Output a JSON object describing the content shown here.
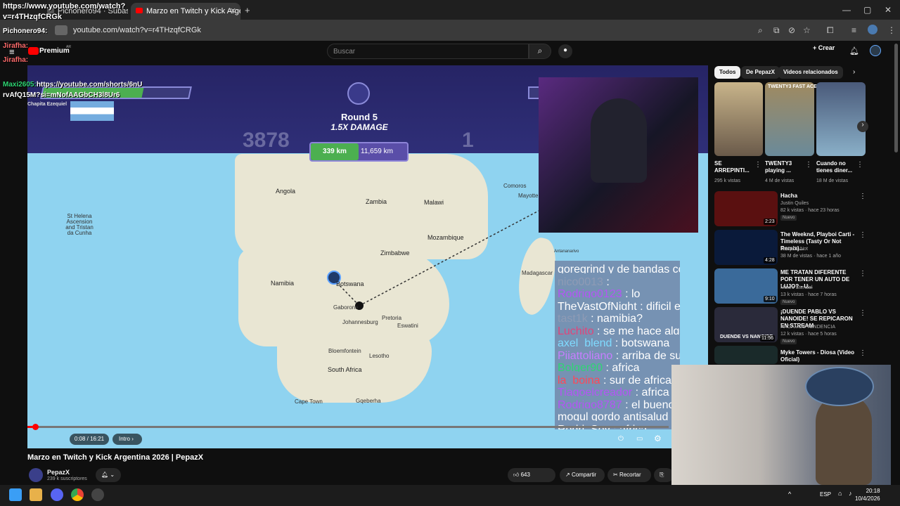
{
  "browser": {
    "tabs": [
      {
        "label": "Pichonero94 · Subasta"
      },
      {
        "label": "Marzo en Twitch y Kick Arge"
      }
    ],
    "url": "youtube.com/watch?v=r4THzqfCRGk",
    "new_tab": "+",
    "tab_close": "✕"
  },
  "youtube": {
    "logo_text": "Premium",
    "logo_sup": "AR",
    "search_placeholder": "Buscar",
    "create_label": "Crear"
  },
  "overlay_chat": [
    {
      "user": "https://www.youtube.com/watch?",
      "msg": ""
    },
    {
      "user": "v=r4THzqfCRGk",
      "msg": ""
    },
    {
      "user": "Pichonero94:",
      "msg": ""
    },
    {
      "user": "Jirafha:",
      "msg": ""
    },
    {
      "user": "Jirafha:",
      "msg": ""
    },
    {
      "user": "Maxi2605:",
      "msg": "https://youtube.com/shorts/6nU"
    },
    {
      "user": "rvAfQ15M?si=mNofAAGbCH3l8Ur6",
      "msg": ""
    }
  ],
  "game": {
    "round_label": "Round 5",
    "damage_label": "1.5X DAMAGE",
    "score_left": "3878",
    "score_right": "1",
    "distance_a": "339 km",
    "distance_b": "11,659 km",
    "player_name": "Chapita Ezequiel",
    "map_labels": [
      "Angola",
      "Zambia",
      "Malawi",
      "Comoros",
      "Mayotte",
      "St Helena Ascension and Tristan da Cunha",
      "Mozambique",
      "Zimbabwe",
      "Namibia",
      "Botswana",
      "Gaborone",
      "Pretoria",
      "Johannesburg",
      "Eswatini",
      "Madagascar",
      "Antananarivo",
      "Bloemfontein",
      "Lesotho",
      "South Africa",
      "Cape Town",
      "Gqeberha"
    ]
  },
  "stream_chat": [
    {
      "user": "",
      "msg": "goregrind y de bandas como gutalax?",
      "color": "#ffffff"
    },
    {
      "user": "nico0013",
      "msg": ":",
      "color": "#8e9bb5"
    },
    {
      "user": "Rodrigo0123",
      "msg": ": lo",
      "color": "#b455f5"
    },
    {
      "user": "TheVastOfNight",
      "msg": ": dificil esta",
      "color": "#ffffff"
    },
    {
      "user": "tast1k",
      "msg": ": namibia?",
      "color": "#8e9bb5"
    },
    {
      "user": "Luchito",
      "msg": ": se me hace algo africano",
      "color": "#e0457b"
    },
    {
      "user": "axel_blend",
      "msg": ": botswana",
      "color": "#7fdbff"
    },
    {
      "user": "Pijattoliano",
      "msg": ": arriba de sudafrica",
      "color": "#c77dff"
    },
    {
      "user": "Bolger90",
      "msg": ": africa",
      "color": "#2ed573"
    },
    {
      "user": "la_boina",
      "msg": ": sur de africa",
      "color": "#ff4757"
    },
    {
      "user": "Tiagoelcreador",
      "msg": ": africa",
      "color": "#b455f5"
    },
    {
      "user": "Rodrigo8787",
      "msg": ": el bueno el malo y el",
      "color": "#b455f5"
    },
    {
      "user": "",
      "msg": "mogul gordo antisalud",
      "color": "#ffffff"
    },
    {
      "user": "Rodri_Sev",
      "msg": ": africa",
      "color": "#ffffff"
    }
  ],
  "player": {
    "time": "0:08 / 16:21",
    "chapter": "Intro",
    "progress_fraction": 0.0082
  },
  "video": {
    "title": "Marzo en Twitch y Kick Argentina 2026 | PepazX",
    "channel": "PepazX",
    "subscribers": "239 k suscriptores",
    "likes": "643",
    "share": "Compartir",
    "clip": "Recortar",
    "save": "Guardar"
  },
  "sidebar": {
    "chips": [
      "Todos",
      "De PepazX",
      "Videos relacionados"
    ],
    "shorts": [
      {
        "title": "SE ARREPINTI...",
        "views": "295 k vistas"
      },
      {
        "title": "TWENTY3 playing ...",
        "views": "4 M de vistas"
      },
      {
        "title": "Cuando no tienes diner...",
        "views": "18 M de vistas"
      }
    ],
    "short_thumb_text": "TWENTY3 FAST ACE",
    "videos": [
      {
        "title": "Hacha",
        "channel": "Justin Quiles",
        "meta": "82 k vistas · hace 23 horas",
        "badge": "Nuevo",
        "duration": "2:23",
        "thumb": "#5a1010"
      },
      {
        "title": "The Weeknd, Playboi Carti - Timeless (Tasty Or Not Remix)...",
        "channel": "Tasty Or Not",
        "meta": "38 M de vistas · hace 1 año",
        "badge": "",
        "duration": "4:28",
        "thumb": "#0a1a3a"
      },
      {
        "title": "ME TRATAN DIFERENTE POR TENER UN AUTO DE LUJO? - U...",
        "channel": "Mauro Stendel",
        "meta": "13 k vistas · hace 7 horas",
        "badge": "Nuevo",
        "duration": "9:10",
        "thumb": "#3a6a9a"
      },
      {
        "title": "¡DUENDE PABLO VS NANOIDE! SE REPICARON EN STREAM",
        "channel": "HAGAMOS TENDENCIA",
        "meta": "12 k vistas · hace 5 horas",
        "badge": "Nuevo",
        "duration": "11:56",
        "thumb": "#2a2a3a"
      },
      {
        "title": "Myke Towers - Diosa (Video Oficial)",
        "channel": "",
        "meta": "",
        "badge": "",
        "duration": "",
        "thumb": "#1a2a2a"
      }
    ],
    "thumb_overlay": "DUENDE VS NANOIDE"
  },
  "taskbar": {
    "lang": "ESP",
    "time": "20:18",
    "date": "10/4/2026"
  },
  "colors": {
    "accent_red": "#ff0000",
    "green": "#4caf50",
    "purple": "#5a4ea8"
  }
}
